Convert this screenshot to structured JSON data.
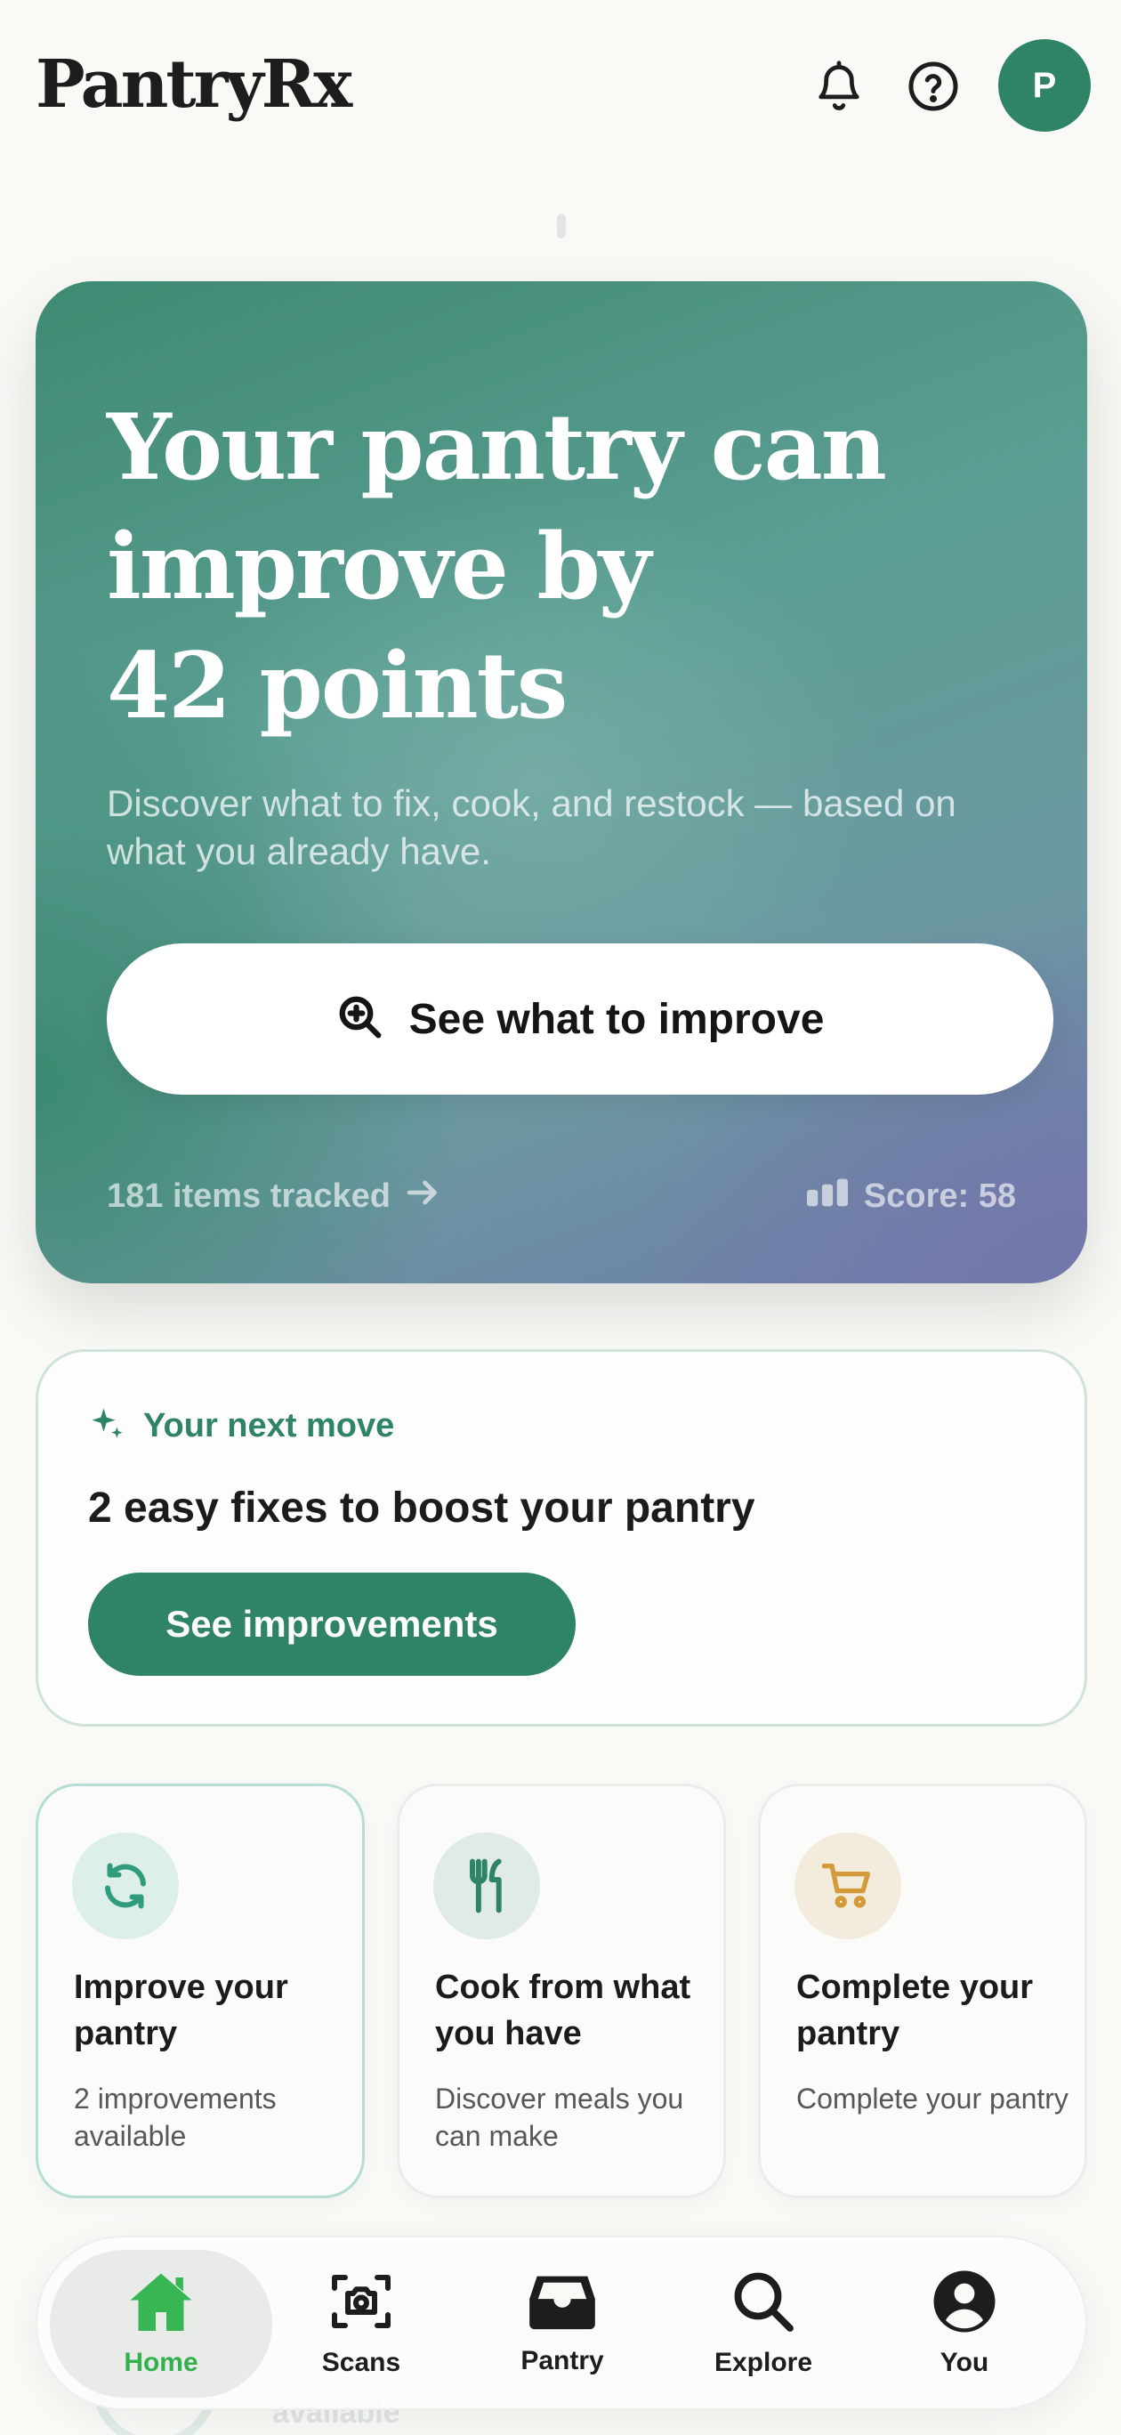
{
  "header": {
    "brand": "PantryRx",
    "avatar_initial": "P",
    "icons": [
      "bell-icon",
      "help-icon"
    ]
  },
  "hero": {
    "title_line1": "Your pantry can",
    "title_line2": "improve by",
    "title_line3": "42 points",
    "subtitle": "Discover what to fix, cook, and restock — based on what you already have.",
    "button_label": "See what to improve",
    "items_tracked": "181 items tracked",
    "score": "Score: 58"
  },
  "next_move": {
    "label": "Your next move",
    "title": "2 easy fixes to boost your pantry",
    "button_label": "See improvements"
  },
  "features": [
    {
      "title": "Improve your pantry",
      "desc": "2 improvements available",
      "icon": "refresh-icon"
    },
    {
      "title": "Cook from what you have",
      "desc": "Discover meals you can make",
      "icon": "fork-knife-icon"
    },
    {
      "title": "Complete your pantry",
      "desc": "Complete your pantry",
      "icon": "cart-icon"
    }
  ],
  "peek": {
    "subtitle": "available"
  },
  "nav": [
    {
      "label": "Home",
      "icon": "home-icon",
      "active": true
    },
    {
      "label": "Scans",
      "icon": "camera-scan-icon",
      "active": false
    },
    {
      "label": "Pantry",
      "icon": "inbox-tray-icon",
      "active": false
    },
    {
      "label": "Explore",
      "icon": "search-icon",
      "active": false
    },
    {
      "label": "You",
      "icon": "user-icon",
      "active": false
    }
  ],
  "colors": {
    "accent": "#2f8466",
    "nav_active": "#33b14e",
    "background": "#f9f9f6"
  }
}
